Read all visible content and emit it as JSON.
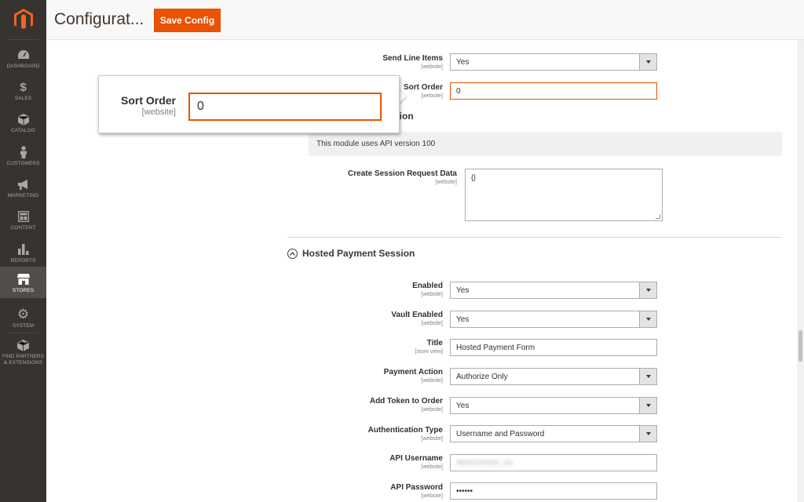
{
  "sidebar": {
    "items": [
      {
        "label": "DASHBOARD",
        "icon": "dashboard-icon"
      },
      {
        "label": "SALES",
        "icon": "dollar-icon"
      },
      {
        "label": "CATALOG",
        "icon": "cube-icon"
      },
      {
        "label": "CUSTOMERS",
        "icon": "person-icon"
      },
      {
        "label": "MARKETING",
        "icon": "megaphone-icon"
      },
      {
        "label": "CONTENT",
        "icon": "layout-icon"
      },
      {
        "label": "REPORTS",
        "icon": "bar-chart-icon"
      },
      {
        "label": "STORES",
        "icon": "store-icon"
      },
      {
        "label": "SYSTEM",
        "icon": "gear-icon"
      },
      {
        "label": "FIND PARTNERS",
        "label2": "& EXTENSIONS",
        "icon": "box-icon"
      }
    ]
  },
  "header": {
    "title": "Configurat...",
    "save_label": "Save Config"
  },
  "form": {
    "send_line_items": {
      "label": "Send Line Items",
      "scope": "[website]",
      "value": "Yes"
    },
    "sort_order": {
      "label": "Sort Order",
      "scope": "[website]",
      "value": "0"
    },
    "partial_heading": "uration",
    "notice": "This module uses API version 100",
    "create_session": {
      "label": "Create Session Request Data",
      "scope": "[website]",
      "value": "{}"
    },
    "section_title": "Hosted Payment Session",
    "enabled": {
      "label": "Enabled",
      "scope": "[website]",
      "value": "Yes"
    },
    "vault_enabled": {
      "label": "Vault Enabled",
      "scope": "[website]",
      "value": "Yes"
    },
    "title": {
      "label": "Title",
      "scope": "[store view]",
      "value": "Hosted Payment Form"
    },
    "payment_action": {
      "label": "Payment Action",
      "scope": "[website]",
      "value": "Authorize Only"
    },
    "add_token": {
      "label": "Add Token to Order",
      "scope": "[website]",
      "value": "Yes"
    },
    "auth_type": {
      "label": "Authentication Type",
      "scope": "[website]",
      "value": "Username and Password"
    },
    "api_username": {
      "label": "API Username",
      "scope": "[website]",
      "value": "TESTCITITEST_CA"
    },
    "api_password": {
      "label": "API Password",
      "scope": "[website]",
      "value": "••••••"
    }
  },
  "callout": {
    "label": "Sort Order",
    "scope": "[website]",
    "value": "0"
  },
  "colors": {
    "accent": "#eb5202",
    "sidebar_bg": "#373330",
    "sidebar_active": "#524d49"
  }
}
